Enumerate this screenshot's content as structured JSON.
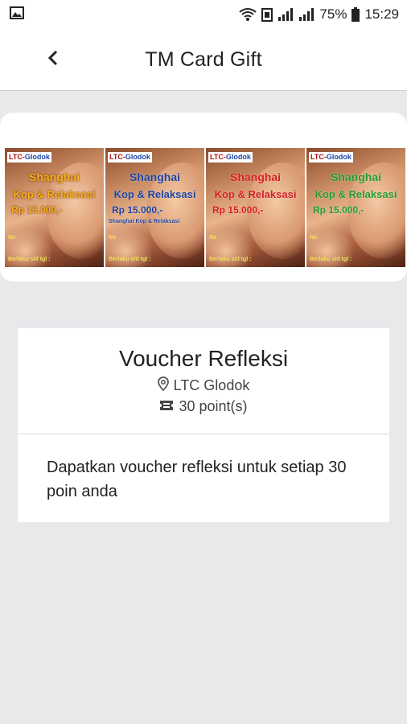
{
  "status_bar": {
    "battery": "75%",
    "time": "15:29"
  },
  "app_bar": {
    "title": "TM Card Gift"
  },
  "gift_cards": [
    {
      "brand": "LTC",
      "brand2": "Glodok",
      "title1": "Shanghai",
      "title2": "Kop & Relaksasi",
      "price": "Rp 15.000,-",
      "subtitle": "",
      "no_label": "No",
      "valid_label": "Berlaku s/d tgl :",
      "color": "orange"
    },
    {
      "brand": "LTC",
      "brand2": "Glodok",
      "title1": "Shanghai",
      "title2": "Kop & Relaksasi",
      "price": "Rp 15.000,-",
      "subtitle": "Shanghai Kop & Relaksasi",
      "no_label": "No",
      "valid_label": "Berlaku s/d tgl :",
      "color": "blue"
    },
    {
      "brand": "LTC",
      "brand2": "Glodok",
      "title1": "Shanghai",
      "title2": "Kop & Relaksasi",
      "price": "Rp 15.000,-",
      "subtitle": "",
      "no_label": "No",
      "valid_label": "Berlaku s/d tgl :",
      "color": "red"
    },
    {
      "brand": "LTC",
      "brand2": "Glodok",
      "title1": "Shanghai",
      "title2": "Kop & Relaksasi",
      "price": "Rp 15.000,-",
      "subtitle": "",
      "no_label": "No",
      "valid_label": "Berlaku s/d tgl :",
      "color": "green"
    }
  ],
  "voucher": {
    "title": "Voucher Refleksi",
    "location": "LTC Glodok",
    "points": "30 point(s)",
    "description": "Dapatkan voucher refleksi untuk setiap 30 poin anda"
  },
  "icons": {
    "back": "arrow-left-icon",
    "location": "map-pin-icon",
    "points": "ticket-icon"
  }
}
